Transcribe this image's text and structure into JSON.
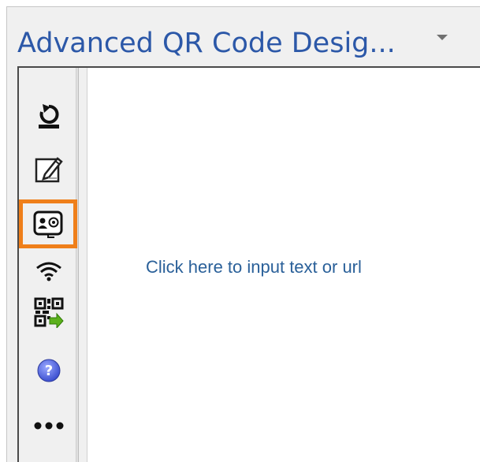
{
  "panel": {
    "title": "Advanced QR Code Desig..."
  },
  "toolbar": {
    "items": [
      {
        "icon": "refresh-icon"
      },
      {
        "icon": "edit-icon"
      },
      {
        "icon": "contact-card-icon",
        "selected": true
      },
      {
        "icon": "wifi-icon"
      },
      {
        "icon": "qr-insert-icon"
      },
      {
        "icon": "help-icon"
      },
      {
        "icon": "more-icon"
      }
    ],
    "highlight_color": "#ef7f1a"
  },
  "canvas": {
    "prompt": "Click here to input text or url",
    "prompt_color": "#2a6099"
  },
  "title_color": "#2c58a8"
}
